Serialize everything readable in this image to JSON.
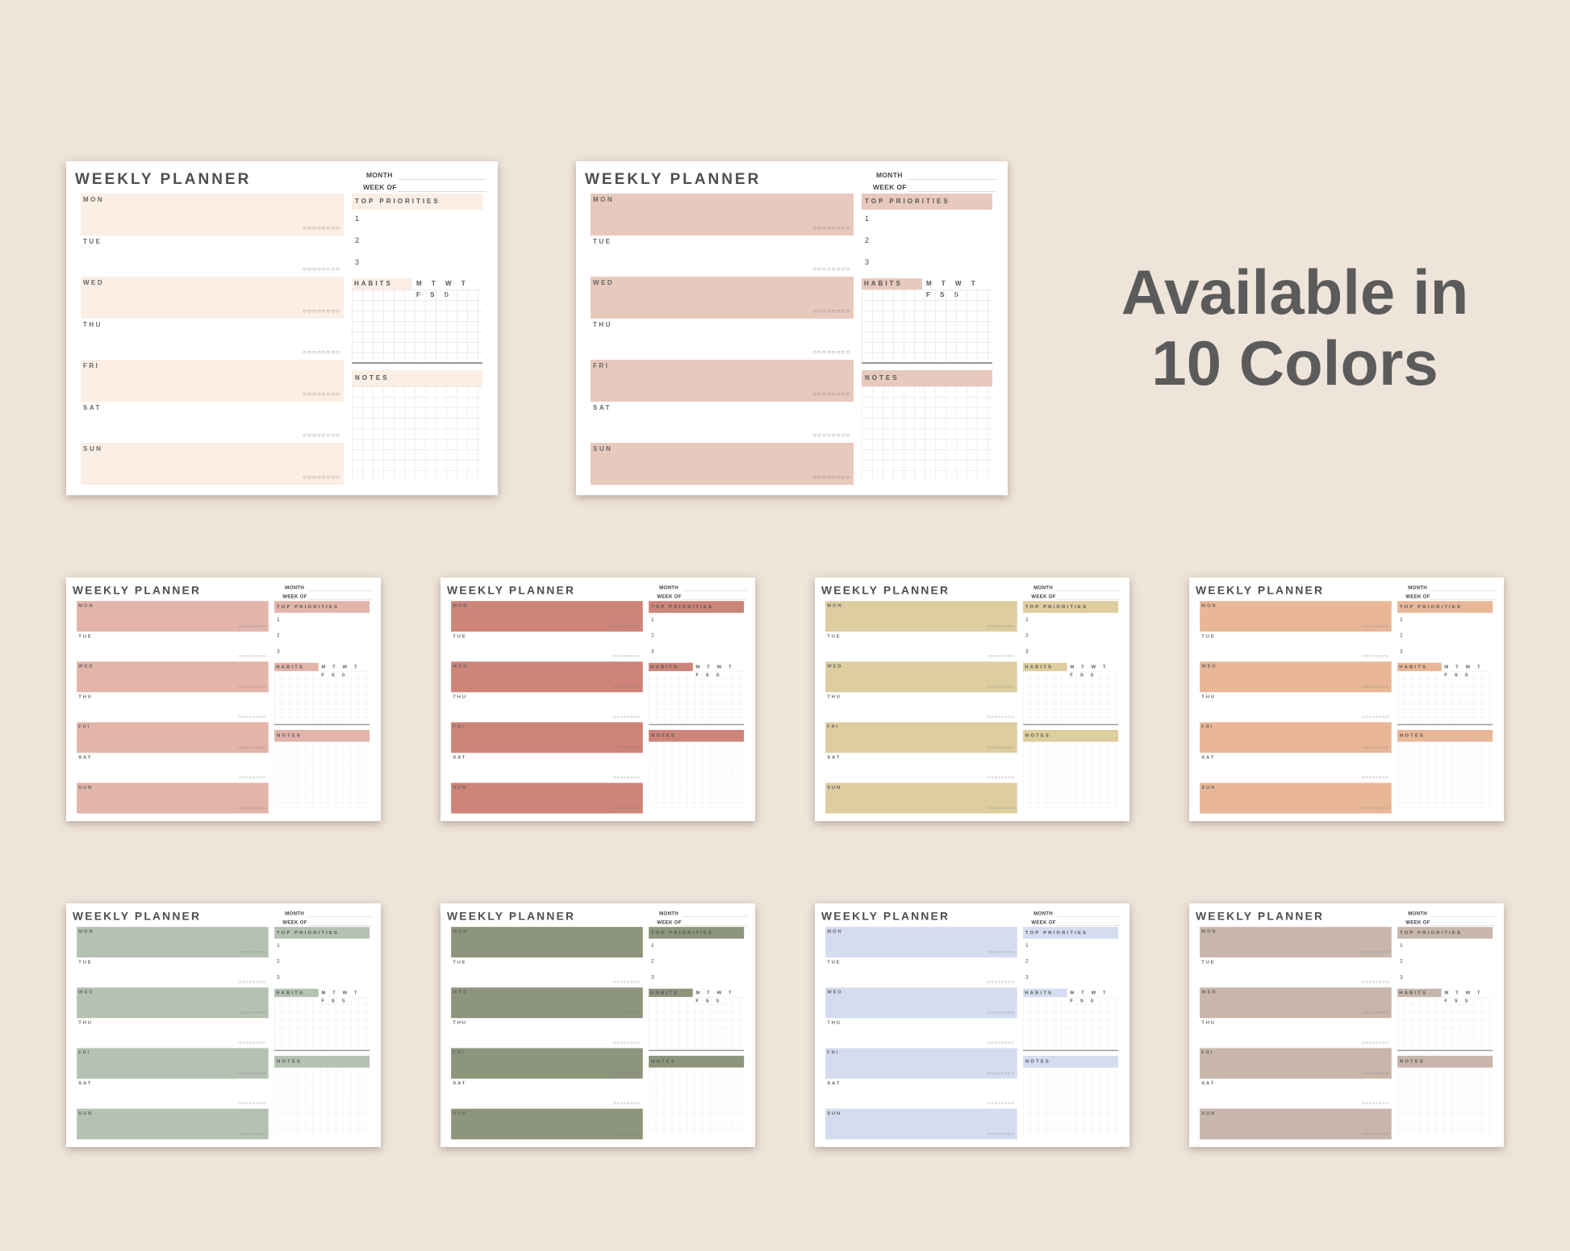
{
  "headline": {
    "line1": "Available in",
    "line2": "10 Colors"
  },
  "planner_template": {
    "title": "WEEKLY PLANNER",
    "month_label": "MONTH",
    "week_label": "WEEK OF",
    "days": [
      "MON",
      "TUE",
      "WED",
      "THU",
      "FRI",
      "SAT",
      "SUN"
    ],
    "drops": "💧",
    "top_priorities_label": "TOP PRIORITIES",
    "priorities": [
      "1",
      "2",
      "3"
    ],
    "habits_label": "HABITS",
    "habit_days": "M T W T F S S",
    "notes_label": "NOTES"
  },
  "colors": [
    "#fbeee4",
    "#e8c9bd",
    "#e2b4aa",
    "#cd8479",
    "#decd9f",
    "#e9b798",
    "#b5c1b3",
    "#8e957d",
    "#d5dcf0",
    "#c8b6ab"
  ]
}
